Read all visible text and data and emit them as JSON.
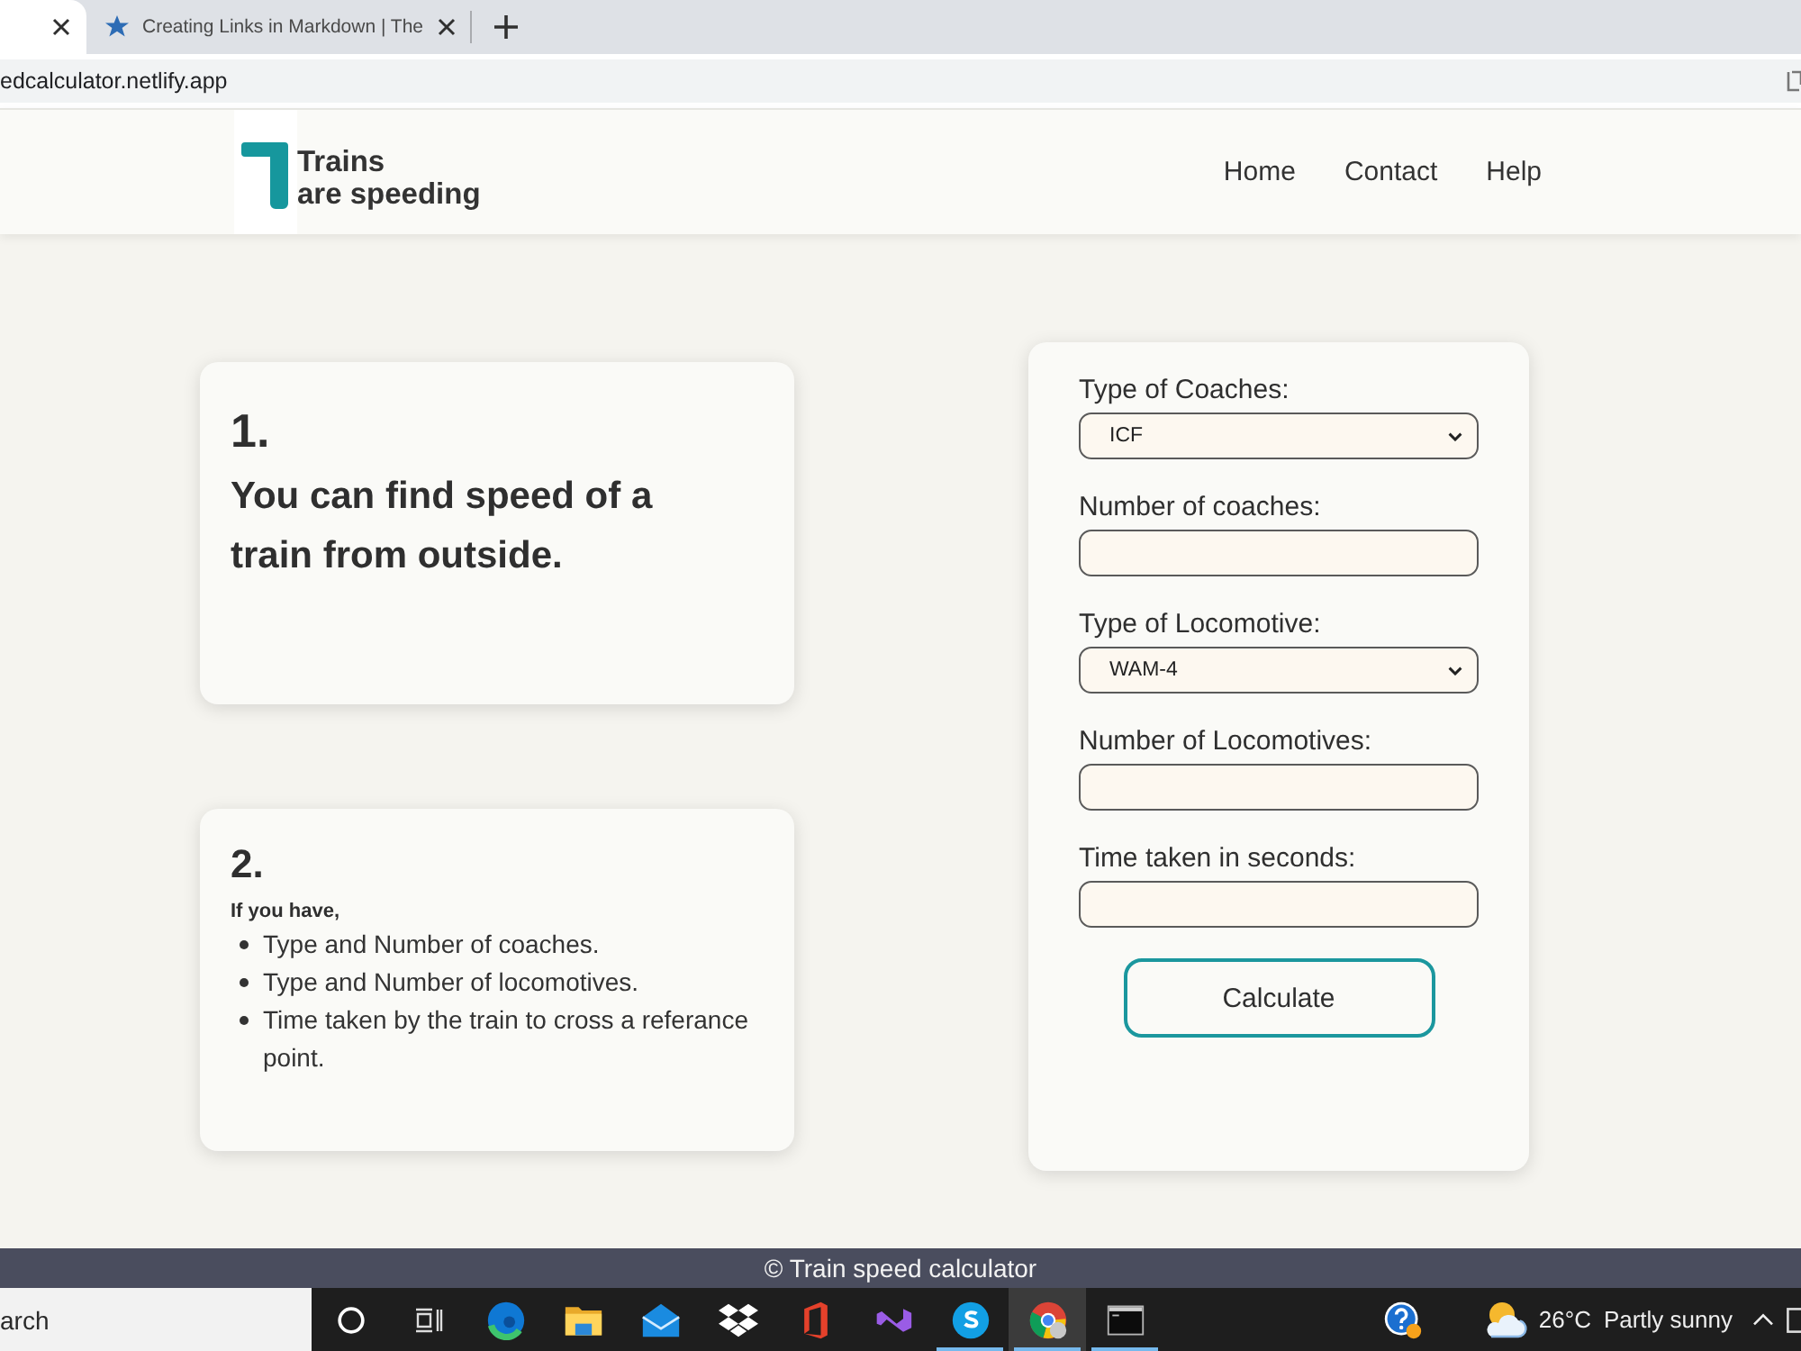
{
  "browser": {
    "tabs": [
      {
        "selected": true
      },
      {
        "title": "Creating Links in Markdown | The",
        "selected": false
      }
    ],
    "address": "edcalculator.netlify.app"
  },
  "header": {
    "logo_text": [
      "Trains",
      "are speeding"
    ],
    "nav": [
      "Home",
      "Contact",
      "Help"
    ]
  },
  "steps": [
    {
      "kind": "heading",
      "number": "1.",
      "title": "You can find speed of a train from outside."
    },
    {
      "kind": "list",
      "number": "2.",
      "intro": "If you have,",
      "items": [
        "Type and Number of coaches.",
        "Type and Number of locomotives.",
        "Time taken by the train to cross a referance point."
      ]
    }
  ],
  "form": {
    "fields": [
      {
        "kind": "select",
        "label": "Type of Coaches:",
        "value": "ICF"
      },
      {
        "kind": "input",
        "label": "Number of coaches:"
      },
      {
        "kind": "select",
        "label": "Type of Locomotive:",
        "value": "WAM-4"
      },
      {
        "kind": "input",
        "label": "Number of Locomotives:"
      },
      {
        "kind": "input",
        "label": "Time taken in seconds:"
      }
    ],
    "button": "Calculate"
  },
  "footer": {
    "text": "© Train speed calculator"
  },
  "taskbar": {
    "search": {
      "placeholder": "arch"
    },
    "apps": [
      {
        "running": false,
        "selected": false
      },
      {
        "running": false,
        "selected": false
      },
      {
        "running": false,
        "selected": false
      },
      {
        "running": false,
        "selected": false
      },
      {
        "running": false,
        "selected": false
      },
      {
        "running": false,
        "selected": false
      },
      {
        "running": true,
        "selected": false
      },
      {
        "running": true,
        "selected": true
      },
      {
        "running": true,
        "selected": false
      }
    ],
    "weather": {
      "temperature": "26°C",
      "condition": "Partly sunny"
    }
  }
}
